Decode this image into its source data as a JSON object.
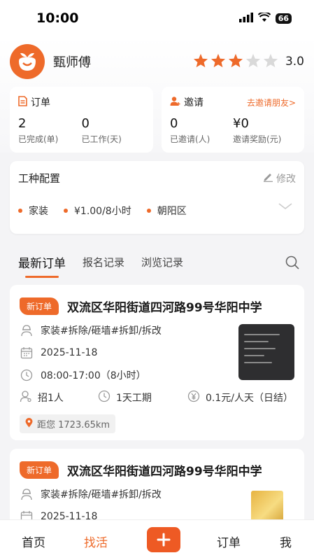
{
  "status": {
    "time": "10:00",
    "battery": "66"
  },
  "profile": {
    "name": "甄师傅",
    "rating": "3.0",
    "stars": 3,
    "max_stars": 5
  },
  "orders_card": {
    "title": "订单",
    "stats": [
      {
        "value": "2",
        "label": "已完成(单)"
      },
      {
        "value": "0",
        "label": "已工作(天)"
      }
    ]
  },
  "invite_card": {
    "title": "邀请",
    "link": "去邀请朋友>",
    "stats": [
      {
        "value": "0",
        "label": "已邀请(人)"
      },
      {
        "value": "¥0",
        "label": "邀请奖励(元)"
      }
    ]
  },
  "config": {
    "title": "工种配置",
    "edit": "修改",
    "tags": [
      "家装",
      "¥1.00/8小时",
      "朝阳区"
    ]
  },
  "tabs": [
    "最新订单",
    "报名记录",
    "浏览记录"
  ],
  "jobs": [
    {
      "badge": "新订单",
      "title": "双流区华阳街道四河路99号华阳中学",
      "type": "家装#拆除/砸墙#拆卸/拆改",
      "date": "2025-11-18",
      "time": "08:00-17:00（8小时）",
      "recruit": "招1人",
      "period": "1天工期",
      "price": "0.1元/人天（日结）",
      "distance": "距您 1723.65km"
    },
    {
      "badge": "新订单",
      "title": "双流区华阳街道四河路99号华阳中学",
      "type": "家装#拆除/砸墙#拆卸/拆改",
      "date": "2025-11-18"
    }
  ],
  "nav": {
    "home": "首页",
    "find": "找活",
    "orders": "订单",
    "me": "我"
  },
  "colors": {
    "accent": "#ee6a2a",
    "background": "#f4f4f6"
  }
}
